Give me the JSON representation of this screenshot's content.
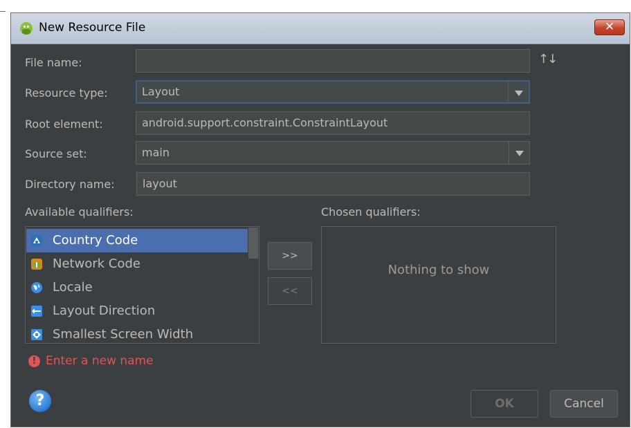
{
  "window": {
    "title": "New Resource File",
    "close_glyph": "✕",
    "stray_glyph": "_"
  },
  "form": {
    "file_name_label": "File name:",
    "file_name_value": "",
    "sort_icon": "↑↓",
    "resource_type_label": "Resource type:",
    "resource_type_value": "Layout",
    "root_element_label": "Root element:",
    "root_element_value": "android.support.constraint.ConstraintLayout",
    "source_set_label": "Source set:",
    "source_set_value": "main",
    "directory_name_label": "Directory name:",
    "directory_name_value": "layout"
  },
  "qualifiers": {
    "available_label": "Available qualifiers:",
    "chosen_label": "Chosen qualifiers:",
    "available": [
      {
        "label": "Country Code",
        "icon": "country-code-icon",
        "selected": true
      },
      {
        "label": "Network Code",
        "icon": "network-code-icon",
        "selected": false
      },
      {
        "label": "Locale",
        "icon": "globe-icon",
        "selected": false
      },
      {
        "label": "Layout Direction",
        "icon": "layout-direction-icon",
        "selected": false
      },
      {
        "label": "Smallest Screen Width",
        "icon": "screen-width-icon",
        "selected": false
      }
    ],
    "chosen_empty": "Nothing to show",
    "add_label": ">>",
    "remove_label": "<<"
  },
  "status": {
    "error_message": "Enter a new name",
    "error_glyph": "!"
  },
  "footer": {
    "help_glyph": "?",
    "ok_label": "OK",
    "cancel_label": "Cancel"
  },
  "colors": {
    "background": "#3c3f41",
    "field": "#45494a",
    "selection": "#4b6eaf",
    "focus_border": "#3d6185",
    "error": "#e05555",
    "text": "#bbbbbb"
  }
}
